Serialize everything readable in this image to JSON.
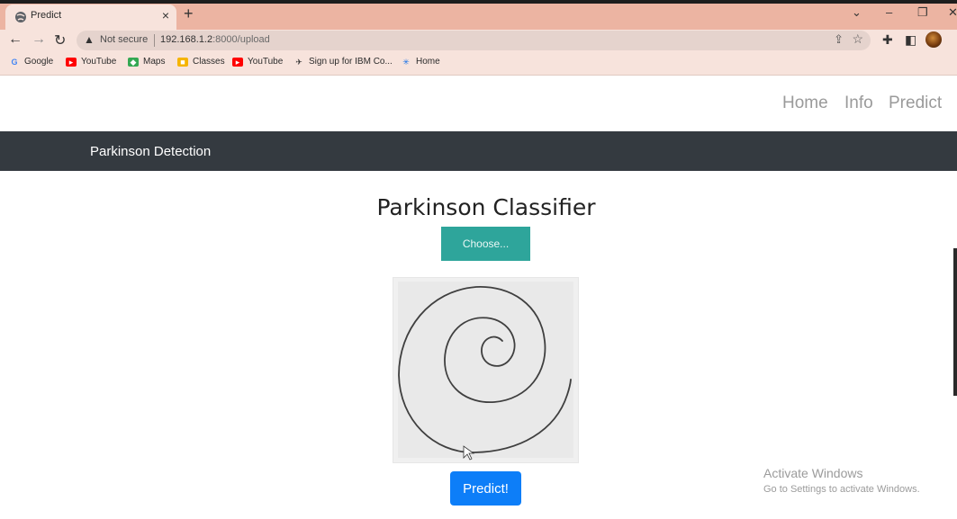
{
  "browser": {
    "tab_title": "Predict",
    "tab_close": "×",
    "new_tab": "+",
    "window": {
      "dropdown": "⌄",
      "minimize": "–",
      "restore": "❐",
      "close": "✕"
    },
    "nav": {
      "back": "←",
      "forward": "→",
      "reload": "↻"
    },
    "address": {
      "security_label": "Not secure",
      "host": "192.168.1.2",
      "path": ":8000/upload"
    },
    "bookmarks": [
      {
        "label": "Google",
        "icon": "google-icon",
        "color": "#4285f4"
      },
      {
        "label": "YouTube",
        "icon": "youtube-icon",
        "color": "#ff0000"
      },
      {
        "label": "Maps",
        "icon": "maps-icon",
        "color": "#34a853"
      },
      {
        "label": "Classes",
        "icon": "classroom-icon",
        "color": "#f5b400"
      },
      {
        "label": "YouTube",
        "icon": "youtube-icon",
        "color": "#ff0000"
      },
      {
        "label": "Sign up for IBM Co...",
        "icon": "ibm-icon",
        "color": "#333333"
      },
      {
        "label": "Home",
        "icon": "home-site-icon",
        "color": "#1a73e8"
      }
    ]
  },
  "page": {
    "top_nav": [
      "Home",
      "Info",
      "Predict"
    ],
    "brand": "Parkinson Detection",
    "heading": "Parkinson Classifier",
    "choose_label": "Choose...",
    "predict_label": "Predict!",
    "colors": {
      "navbar": "#343a40",
      "choose": "#2ea59b",
      "predict": "#0d7ef8"
    }
  },
  "watermark": {
    "line1": "Activate Windows",
    "line2": "Go to Settings to activate Windows."
  }
}
